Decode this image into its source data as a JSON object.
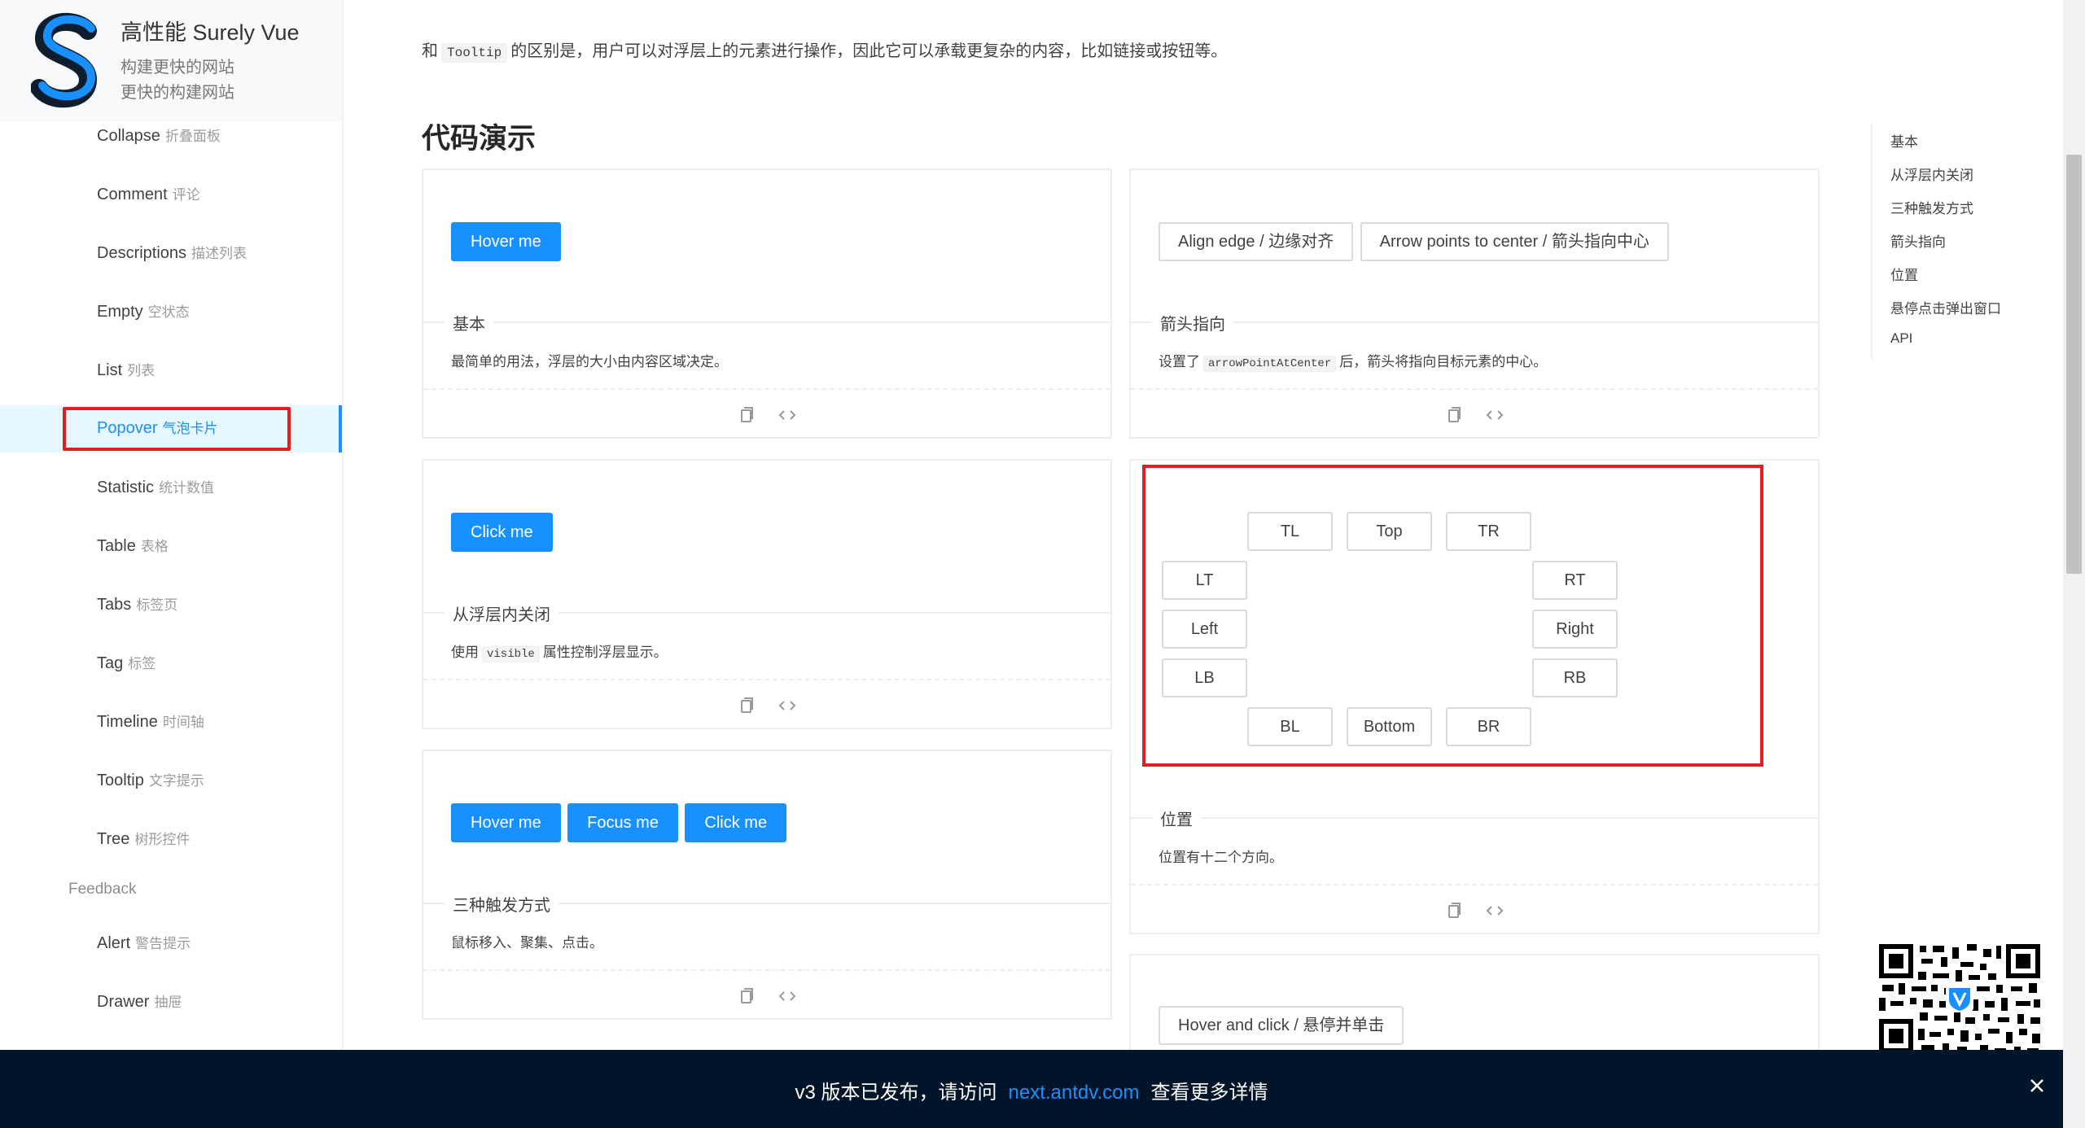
{
  "brand": {
    "title": "高性能 Surely Vue",
    "subtitle1": "构建更快的网站",
    "subtitle2": "更快的构建网站"
  },
  "sidebar": {
    "items": [
      {
        "label": "Collapse",
        "sub": "折叠面板"
      },
      {
        "label": "Comment",
        "sub": "评论"
      },
      {
        "label": "Descriptions",
        "sub": "描述列表"
      },
      {
        "label": "Empty",
        "sub": "空状态"
      },
      {
        "label": "List",
        "sub": "列表"
      },
      {
        "label": "Popover",
        "sub": "气泡卡片"
      },
      {
        "label": "Statistic",
        "sub": "统计数值"
      },
      {
        "label": "Table",
        "sub": "表格"
      },
      {
        "label": "Tabs",
        "sub": "标签页"
      },
      {
        "label": "Tag",
        "sub": "标签"
      },
      {
        "label": "Timeline",
        "sub": "时间轴"
      },
      {
        "label": "Tooltip",
        "sub": "文字提示"
      },
      {
        "label": "Tree",
        "sub": "树形控件"
      }
    ],
    "group_feedback": "Feedback",
    "feedback_items": [
      {
        "label": "Alert",
        "sub": "警告提示"
      },
      {
        "label": "Drawer",
        "sub": "抽屉"
      }
    ]
  },
  "intro": {
    "line_a": "和",
    "line_code": "Tooltip",
    "line_b": "的区别是，用户可以对浮层上的元素进行操作，因此它可以承载更复杂的内容，比如链接或按钮等。"
  },
  "section_title": "代码演示",
  "demos": {
    "basic": {
      "button": "Hover me",
      "title": "基本",
      "desc": "最简单的用法，浮层的大小由内容区域决定。"
    },
    "arrow": {
      "button1": "Align edge / 边缘对齐",
      "button2": "Arrow points to center / 箭头指向中心",
      "title": "箭头指向",
      "desc_a": "设置了",
      "desc_code": "arrowPointAtCenter",
      "desc_b": "后，箭头将指向目标元素的中心。"
    },
    "close": {
      "button": "Click me",
      "title": "从浮层内关闭",
      "desc_a": "使用",
      "desc_code": "visible",
      "desc_b": "属性控制浮层显示。"
    },
    "placement": {
      "buttons": {
        "tl": "TL",
        "top": "Top",
        "tr": "TR",
        "lt": "LT",
        "left": "Left",
        "lb": "LB",
        "rt": "RT",
        "right": "Right",
        "rb": "RB",
        "bl": "BL",
        "bottom": "Bottom",
        "br": "BR"
      },
      "title": "位置",
      "desc": "位置有十二个方向。"
    },
    "trigger": {
      "button1": "Hover me",
      "button2": "Focus me",
      "button3": "Click me",
      "title": "三种触发方式",
      "desc": "鼠标移入、聚集、点击。"
    },
    "hover_click": {
      "button": "Hover and click / 悬停并单击"
    }
  },
  "toc": [
    "基本",
    "从浮层内关闭",
    "三种触发方式",
    "箭头指向",
    "位置",
    "悬停点击弹出窗口",
    "API"
  ],
  "banner": {
    "text_a": "v3 版本已发布，请访问",
    "link": "next.antdv.com",
    "text_b": "查看更多详情"
  },
  "colors": {
    "primary": "#1890ff",
    "highlight": "#e02020",
    "banner_bg": "#001529"
  },
  "icons": {
    "copy": "copy-icon",
    "code": "code-icon",
    "close": "close-icon"
  }
}
